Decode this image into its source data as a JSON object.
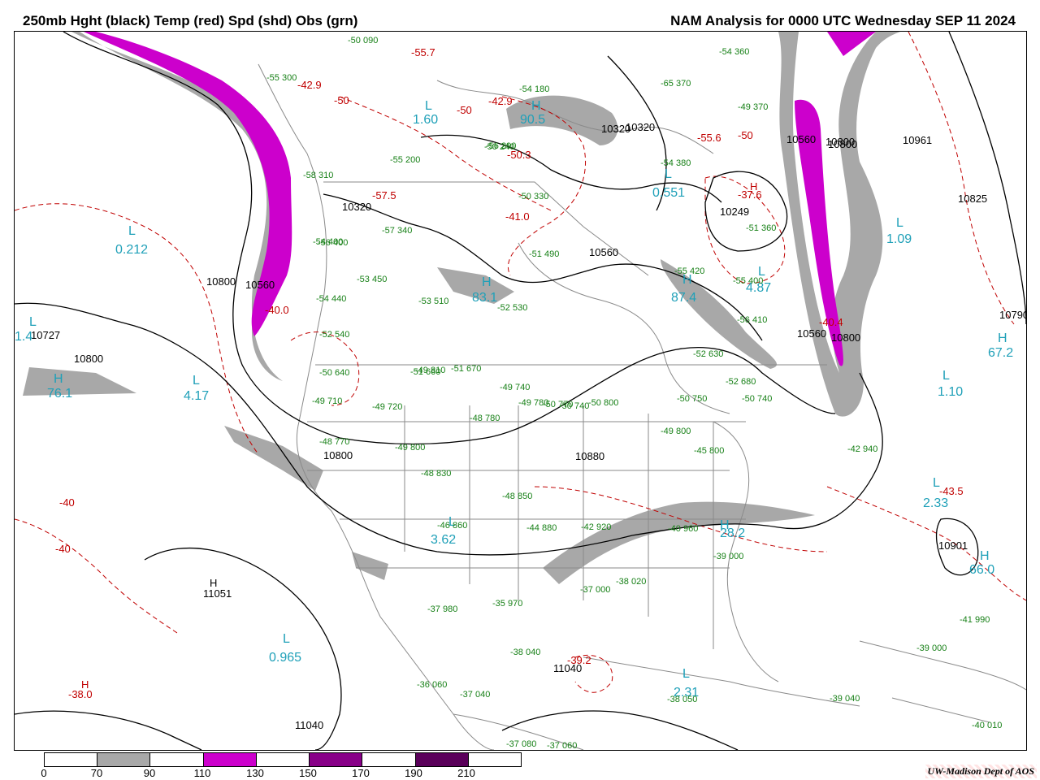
{
  "header": {
    "left_title": "250mb Hght (black) Temp (red) Spd (shd) Obs (grn)",
    "right_title": "NAM Analysis for 0000 UTC Wednesday  SEP 11 2024"
  },
  "credit": "UW-Madison  Dept of AOS",
  "colors": {
    "height_contour": "#000000",
    "temperature_contour": "#c00000",
    "speed_70_90": "#a8a8a8",
    "speed_110_130": "#cc00cc",
    "speed_150_170": "#880088",
    "speed_190_210": "#5a005a",
    "observation": "#178017",
    "pressure_center": "#1fa0b8",
    "geography": "#8a8a8a"
  },
  "speed_scale": {
    "labels": [
      "0",
      "70",
      "90",
      "110",
      "130",
      "150",
      "170",
      "190",
      "210"
    ],
    "fills": [
      "#ffffff",
      "#a8a8a8",
      "#ffffff",
      "#cc00cc",
      "#ffffff",
      "#880088",
      "#ffffff",
      "#5a005a",
      "#ffffff"
    ]
  },
  "height_labels": [
    "10320",
    "10320",
    "10560",
    "10800",
    "10560",
    "10800",
    "10727",
    "10800",
    "11051",
    "11040",
    "11040",
    "10800",
    "10880",
    "10249",
    "10320",
    "10560",
    "10800",
    "10961",
    "10825",
    "10560",
    "10800",
    "10901",
    "10790"
  ],
  "temperature_labels": [
    "-55.7",
    "-42.9",
    "-50",
    "-50",
    "-42.9",
    "-50.3",
    "-57.5",
    "-41.0",
    "-55.6",
    "-50",
    "-37.6",
    "-40.0",
    "-40",
    "-40",
    "-38.0",
    "-39.2",
    "-43.5",
    "-40.4"
  ],
  "center_values": [
    "0.212",
    "1.60",
    "90.5",
    "0.551",
    "83.1",
    "87.4",
    "4.87",
    "76.1",
    "4.17",
    "3.62",
    "0.965",
    "28.2",
    "2.31",
    "1.09",
    "67.2",
    "1.10",
    "2.33",
    "66.0",
    "1.4"
  ],
  "observations": [
    "-50 090",
    "-54 360",
    "-65 370",
    "-49 370",
    "-56 290",
    "-55 300",
    "-58 310",
    "-56 400",
    "-54 440",
    "-52 540",
    "-50 640",
    "-49 710",
    "-49 720",
    "-48 770",
    "-49 800",
    "-48 830",
    "-48 850",
    "-46 860",
    "-44 880",
    "-42 920",
    "-40 960",
    "-39 000",
    "-37 000",
    "-38 020",
    "-35 970",
    "-37 980",
    "-38 040",
    "-36 060",
    "-37 040",
    "-37 080",
    "-37 060",
    "-38 050",
    "-39 040",
    "-41 990",
    "-39 000",
    "-40 010",
    "-42 940",
    "-45 800",
    "-49 800",
    "-50 770",
    "-49 810",
    "-48 780",
    "-51 660",
    "-51 670",
    "-49 740",
    "-49 780",
    "-50 740",
    "-50 800",
    "-53 510",
    "-52 530",
    "-55 420",
    "-52 630",
    "-52 680",
    "-50 750",
    "-50 740",
    "-51 360",
    "-55 400",
    "-56 410",
    "-54 380",
    "-51 490",
    "-50 330",
    "-55 200",
    "-57 340",
    "-53 450",
    "-54 400",
    "-54 180",
    "-50 240"
  ]
}
